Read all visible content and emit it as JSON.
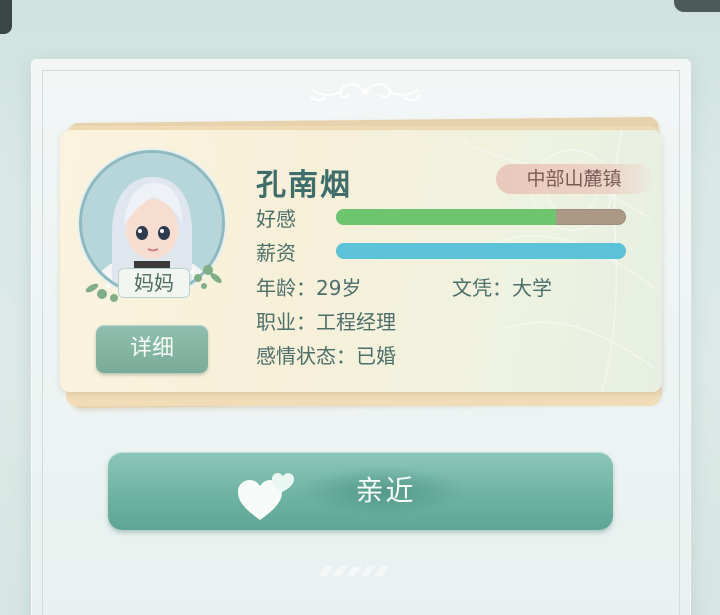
{
  "character": {
    "name": "孔南烟",
    "location": "中部山麓镇",
    "relation": "妈妈"
  },
  "stats": {
    "affinity_label": "好感",
    "affinity_value": 0.76,
    "salary_label": "薪资",
    "salary_value": 1.0
  },
  "info": {
    "age_label": "年龄：",
    "age_value": "29岁",
    "education_label": "文凭：",
    "education_value": "大学",
    "job_label": "职业：",
    "job_value": "工程经理",
    "marital_label": "感情状态：",
    "marital_value": "已婚"
  },
  "buttons": {
    "detail": "详细",
    "approach": "亲近"
  },
  "colors": {
    "affinity_fill": "#6dc56e",
    "affinity_track": "#ac9985",
    "salary_fill": "#5cc2d9",
    "accent_teal": "#6fb3a3",
    "location_tag": "#e8c9bb"
  },
  "icons": {
    "hearts": "hearts-icon",
    "ornament": "ornament-icon"
  }
}
